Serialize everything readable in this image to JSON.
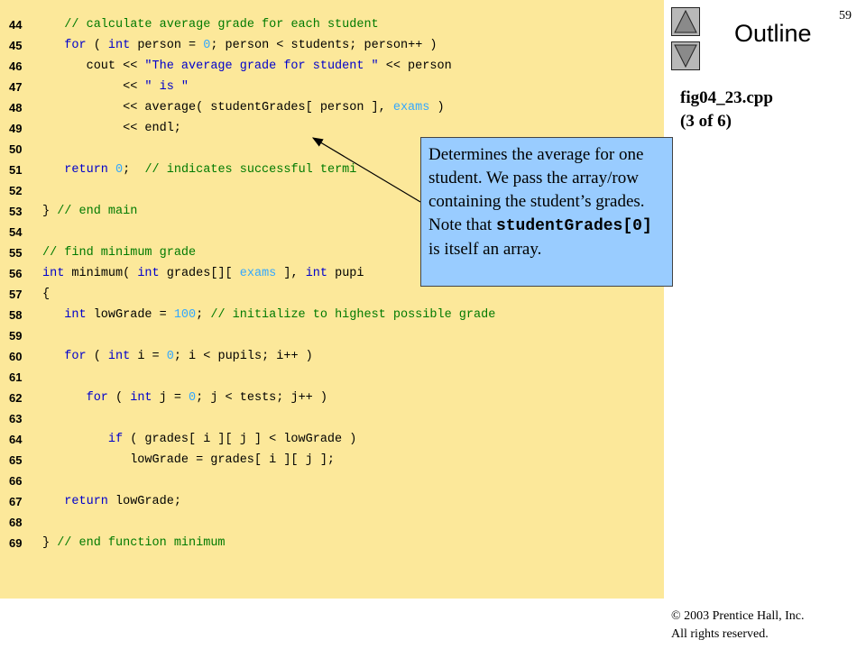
{
  "slide": {
    "page_number": "59",
    "outline_title": "Outline",
    "file_name": "fig04_23.cpp",
    "file_part": "(3 of 6)"
  },
  "nav": {
    "up_icon": "triangle-up-icon",
    "down_icon": "triangle-down-icon"
  },
  "callout": {
    "text_before": "Determines the average for one student. We pass the array/row containing the student’s grades. Note that ",
    "code": "studentGrades[0]",
    "text_after": " is itself an array."
  },
  "copyright": {
    "line1": "© 2003 Prentice Hall, Inc.",
    "line2": "All rights reserved."
  },
  "colors": {
    "code_background": "#fce89a",
    "callout_background": "#99ccff",
    "keyword": "#0000cc",
    "comment": "#007a00",
    "number": "#33a8ff"
  },
  "code_lines": [
    {
      "n": "44",
      "indent": 3,
      "tokens": [
        {
          "t": "// calculate average grade for each student",
          "c": "com"
        }
      ]
    },
    {
      "n": "45",
      "indent": 3,
      "tokens": [
        {
          "t": "for",
          "c": "kw"
        },
        {
          "t": " ( ",
          "c": "txt"
        },
        {
          "t": "int",
          "c": "kw"
        },
        {
          "t": " person = ",
          "c": "txt"
        },
        {
          "t": "0",
          "c": "num"
        },
        {
          "t": "; person < students; person++ )",
          "c": "txt"
        }
      ]
    },
    {
      "n": "46",
      "indent": 6,
      "tokens": [
        {
          "t": "cout << ",
          "c": "txt"
        },
        {
          "t": "\"The average grade for student \"",
          "c": "str"
        },
        {
          "t": " << person",
          "c": "txt"
        }
      ]
    },
    {
      "n": "47",
      "indent": 11,
      "tokens": [
        {
          "t": "<< ",
          "c": "txt"
        },
        {
          "t": "\" is \"",
          "c": "str"
        }
      ]
    },
    {
      "n": "48",
      "indent": 11,
      "tokens": [
        {
          "t": "<< average( studentGrades[ person ], ",
          "c": "txt"
        },
        {
          "t": "exams",
          "c": "num"
        },
        {
          "t": " )",
          "c": "txt"
        }
      ]
    },
    {
      "n": "49",
      "indent": 11,
      "tokens": [
        {
          "t": "<< endl;",
          "c": "txt"
        }
      ]
    },
    {
      "n": "50",
      "indent": 0,
      "tokens": []
    },
    {
      "n": "51",
      "indent": 3,
      "tokens": [
        {
          "t": "return",
          "c": "kw"
        },
        {
          "t": " ",
          "c": "txt"
        },
        {
          "t": "0",
          "c": "num"
        },
        {
          "t": ";  ",
          "c": "txt"
        },
        {
          "t": "// indicates successful termi",
          "c": "com"
        }
      ]
    },
    {
      "n": "52",
      "indent": 0,
      "tokens": []
    },
    {
      "n": "53",
      "indent": 0,
      "tokens": [
        {
          "t": "} ",
          "c": "txt"
        },
        {
          "t": "// end main",
          "c": "com"
        }
      ]
    },
    {
      "n": "54",
      "indent": 0,
      "tokens": []
    },
    {
      "n": "55",
      "indent": 0,
      "tokens": [
        {
          "t": "// find minimum grade",
          "c": "com"
        }
      ]
    },
    {
      "n": "56",
      "indent": 0,
      "tokens": [
        {
          "t": "int",
          "c": "kw"
        },
        {
          "t": " minimum( ",
          "c": "txt"
        },
        {
          "t": "int",
          "c": "kw"
        },
        {
          "t": " grades[][ ",
          "c": "txt"
        },
        {
          "t": "exams",
          "c": "num"
        },
        {
          "t": " ], ",
          "c": "txt"
        },
        {
          "t": "int",
          "c": "kw"
        },
        {
          "t": " pupi",
          "c": "txt"
        }
      ]
    },
    {
      "n": "57",
      "indent": 0,
      "tokens": [
        {
          "t": "{",
          "c": "txt"
        }
      ]
    },
    {
      "n": "58",
      "indent": 3,
      "tokens": [
        {
          "t": "int",
          "c": "kw"
        },
        {
          "t": " lowGrade = ",
          "c": "txt"
        },
        {
          "t": "100",
          "c": "num"
        },
        {
          "t": "; ",
          "c": "txt"
        },
        {
          "t": "// initialize to highest possible grade",
          "c": "com"
        }
      ]
    },
    {
      "n": "59",
      "indent": 0,
      "tokens": []
    },
    {
      "n": "60",
      "indent": 3,
      "tokens": [
        {
          "t": "for",
          "c": "kw"
        },
        {
          "t": " ( ",
          "c": "txt"
        },
        {
          "t": "int",
          "c": "kw"
        },
        {
          "t": " i = ",
          "c": "txt"
        },
        {
          "t": "0",
          "c": "num"
        },
        {
          "t": "; i < pupils; i++ )",
          "c": "txt"
        }
      ]
    },
    {
      "n": "61",
      "indent": 0,
      "tokens": []
    },
    {
      "n": "62",
      "indent": 6,
      "tokens": [
        {
          "t": "for",
          "c": "kw"
        },
        {
          "t": " ( ",
          "c": "txt"
        },
        {
          "t": "int",
          "c": "kw"
        },
        {
          "t": " j = ",
          "c": "txt"
        },
        {
          "t": "0",
          "c": "num"
        },
        {
          "t": "; j < tests; j++ )",
          "c": "txt"
        }
      ]
    },
    {
      "n": "63",
      "indent": 0,
      "tokens": []
    },
    {
      "n": "64",
      "indent": 9,
      "tokens": [
        {
          "t": "if",
          "c": "kw"
        },
        {
          "t": " ( grades[ i ][ j ] < lowGrade )",
          "c": "txt"
        }
      ]
    },
    {
      "n": "65",
      "indent": 12,
      "tokens": [
        {
          "t": "lowGrade = grades[ i ][ j ];",
          "c": "txt"
        }
      ]
    },
    {
      "n": "66",
      "indent": 0,
      "tokens": []
    },
    {
      "n": "67",
      "indent": 3,
      "tokens": [
        {
          "t": "return",
          "c": "kw"
        },
        {
          "t": " lowGrade;",
          "c": "txt"
        }
      ]
    },
    {
      "n": "68",
      "indent": 0,
      "tokens": []
    },
    {
      "n": "69",
      "indent": 0,
      "tokens": [
        {
          "t": "} ",
          "c": "txt"
        },
        {
          "t": "// end function minimum",
          "c": "com"
        }
      ]
    }
  ]
}
